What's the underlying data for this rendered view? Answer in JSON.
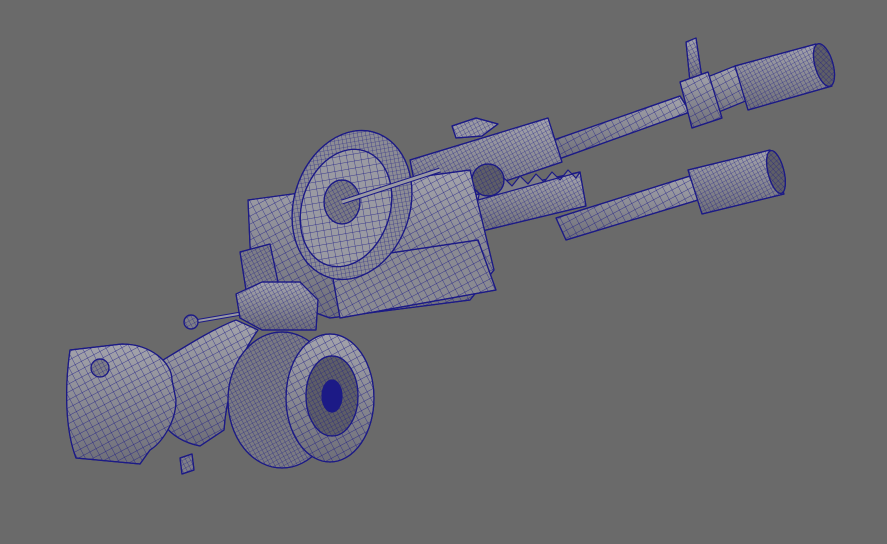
{
  "viewport": {
    "background_color": "#6a6a6a",
    "wire_color": "#1c1a86",
    "shade_light": "#9a9aa2",
    "shade_mid": "#7e7e86",
    "shade_dark": "#5e5e66",
    "display_mode": "wireframe-on-shaded"
  },
  "model": {
    "subject": "gun-model",
    "parts": [
      "upper-barrel",
      "lower-barrel",
      "front-sight",
      "wheel",
      "rack-gear",
      "receiver",
      "drum-magazine",
      "grip",
      "stock",
      "cocking-lever",
      "trigger"
    ]
  }
}
